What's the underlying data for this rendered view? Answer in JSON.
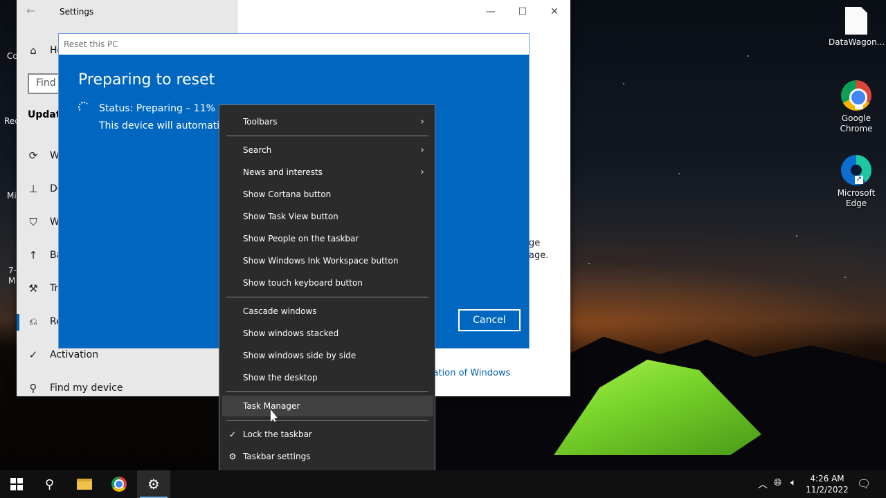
{
  "desktop": {
    "icons": [
      {
        "label": "DataWagon..."
      },
      {
        "label": "Google\nChrome"
      },
      {
        "label": "Microsoft\nEdge"
      }
    ]
  },
  "settings": {
    "title": "Settings",
    "search_placeholder": "Find",
    "section": "Update",
    "nav": [
      "Ho",
      "W",
      "De",
      "W",
      "Ba",
      "Tr",
      "Re",
      "Activation",
      "Find my device"
    ],
    "right_fragments": [
      "ge",
      "age."
    ],
    "link_fragment": "lation of Windows",
    "left_edge_fragments": [
      "Co",
      "Rec",
      "Mi",
      "7-",
      "M"
    ]
  },
  "reset": {
    "title": "Reset this PC",
    "heading": "Preparing to reset",
    "status": "Status: Preparing – 11%",
    "note": "This device will automatica",
    "cancel": "Cancel"
  },
  "context_menu": {
    "items": [
      {
        "label": "Toolbars",
        "submenu": true
      },
      {
        "label": "Search",
        "submenu": true
      },
      {
        "label": "News and interests",
        "submenu": true
      },
      {
        "label": "Show Cortana button"
      },
      {
        "label": "Show Task View button"
      },
      {
        "label": "Show People on the taskbar"
      },
      {
        "label": "Show Windows Ink Workspace button"
      },
      {
        "label": "Show touch keyboard button"
      },
      {
        "label": "Cascade windows"
      },
      {
        "label": "Show windows stacked"
      },
      {
        "label": "Show windows side by side"
      },
      {
        "label": "Show the desktop"
      },
      {
        "label": "Task Manager",
        "highlighted": true
      },
      {
        "label": "Lock the taskbar",
        "checked": true
      },
      {
        "label": "Taskbar settings",
        "icon": "gear-icon"
      }
    ]
  },
  "taskbar": {
    "time": "4:26 AM",
    "date": "11/2/2022",
    "accent_color": "#76b9ed"
  },
  "colors": {
    "dialog_blue": "#0067c0",
    "menu_bg": "#2b2b2b",
    "link_blue": "#0063b1"
  }
}
